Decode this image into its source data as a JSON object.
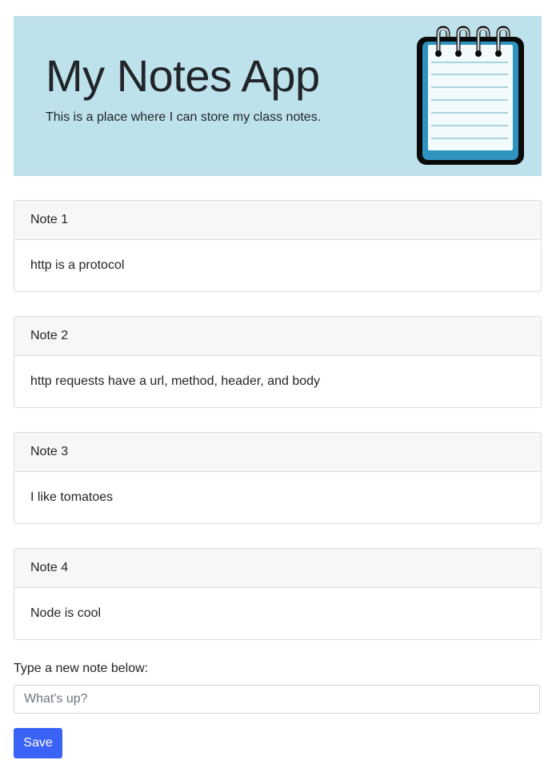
{
  "header": {
    "title": "My Notes App",
    "subtitle": "This is a place where I can store my class notes.",
    "logo_icon": "notepad-icon"
  },
  "notes": [
    {
      "title": "Note 1",
      "body": "http is a protocol"
    },
    {
      "title": "Note 2",
      "body": "http requests have a url, method, header, and body"
    },
    {
      "title": "Note 3",
      "body": "I like tomatoes"
    },
    {
      "title": "Note 4",
      "body": "Node is cool"
    }
  ],
  "form": {
    "label": "Type a new note below:",
    "placeholder": "What's up?",
    "value": "",
    "save_label": "Save"
  },
  "colors": {
    "header_bg": "#bee2eb",
    "card_header_bg": "#f7f7f7",
    "button_bg": "#3a63f5",
    "notepad_frame": "#2f93c0"
  }
}
